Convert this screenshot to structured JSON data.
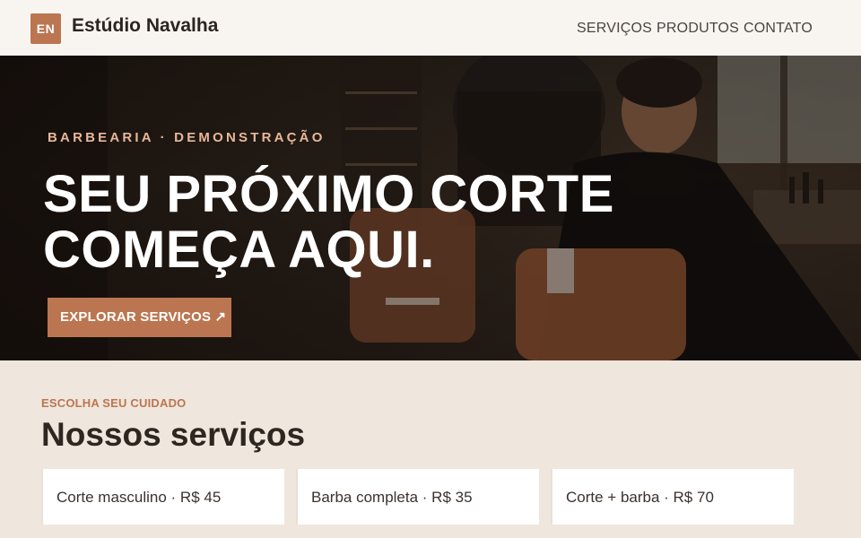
{
  "header": {
    "logo_initials": "EN",
    "brand": "Estúdio Navalha",
    "nav": [
      "SERVIÇOS",
      "PRODUTOS",
      "CONTATO"
    ]
  },
  "hero": {
    "kicker": "BARBEARIA · DEMONSTRAÇÃO",
    "title_line1": "SEU PRÓXIMO CORTE",
    "title_line2": "COMEÇA AQUI.",
    "cta": "EXPLORAR SERVIÇOS ↗"
  },
  "services": {
    "kicker": "ESCOLHA SEU CUIDADO",
    "title": "Nossos serviços",
    "items": [
      {
        "label": "Corte masculino · R$ 45"
      },
      {
        "label": "Barba completa · R$ 35"
      },
      {
        "label": "Corte + barba · R$ 70"
      }
    ]
  },
  "colors": {
    "accent": "#bb7651",
    "background": "#efe6dd",
    "header_bg": "#f8f5f1"
  }
}
